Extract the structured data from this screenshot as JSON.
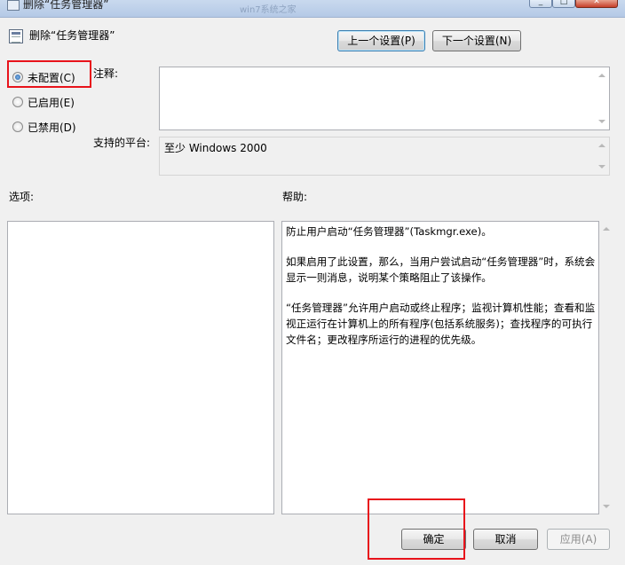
{
  "window": {
    "title": "删除“任务管理器”",
    "watermark": "win7系统之家",
    "caption_buttons": [
      "minimize",
      "maximize",
      "close"
    ]
  },
  "header": {
    "policy_icon": "policy-setting-icon",
    "title": "删除“任务管理器”",
    "prev_button": "上一个设置(P)",
    "next_button": "下一个设置(N)"
  },
  "state": {
    "options": [
      {
        "label": "未配置(C)",
        "checked": true
      },
      {
        "label": "已启用(E)",
        "checked": false
      },
      {
        "label": "已禁用(D)",
        "checked": false
      }
    ]
  },
  "comment": {
    "label": "注释:",
    "value": ""
  },
  "platform": {
    "label": "支持的平台:",
    "value": "至少 Windows 2000"
  },
  "options_panel": {
    "label": "选项:"
  },
  "help_panel": {
    "label": "帮助:",
    "paragraphs": [
      "防止用户启动“任务管理器”(Taskmgr.exe)。",
      "如果启用了此设置，那么，当用户尝试启动“任务管理器”时，系统会显示一则消息，说明某个策略阻止了该操作。",
      "“任务管理器”允许用户启动或终止程序；监视计算机性能；查看和监视正运行在计算机上的所有程序(包括系统服务)；查找程序的可执行文件名；更改程序所运行的进程的优先级。"
    ]
  },
  "footer": {
    "ok_button": "确定",
    "cancel_button": "取消",
    "apply_button": "应用(A)"
  },
  "colors": {
    "highlight_box": "#e8131b",
    "dialog_bg": "#f0f0f0",
    "radio_selected": "#1f5fa8"
  }
}
